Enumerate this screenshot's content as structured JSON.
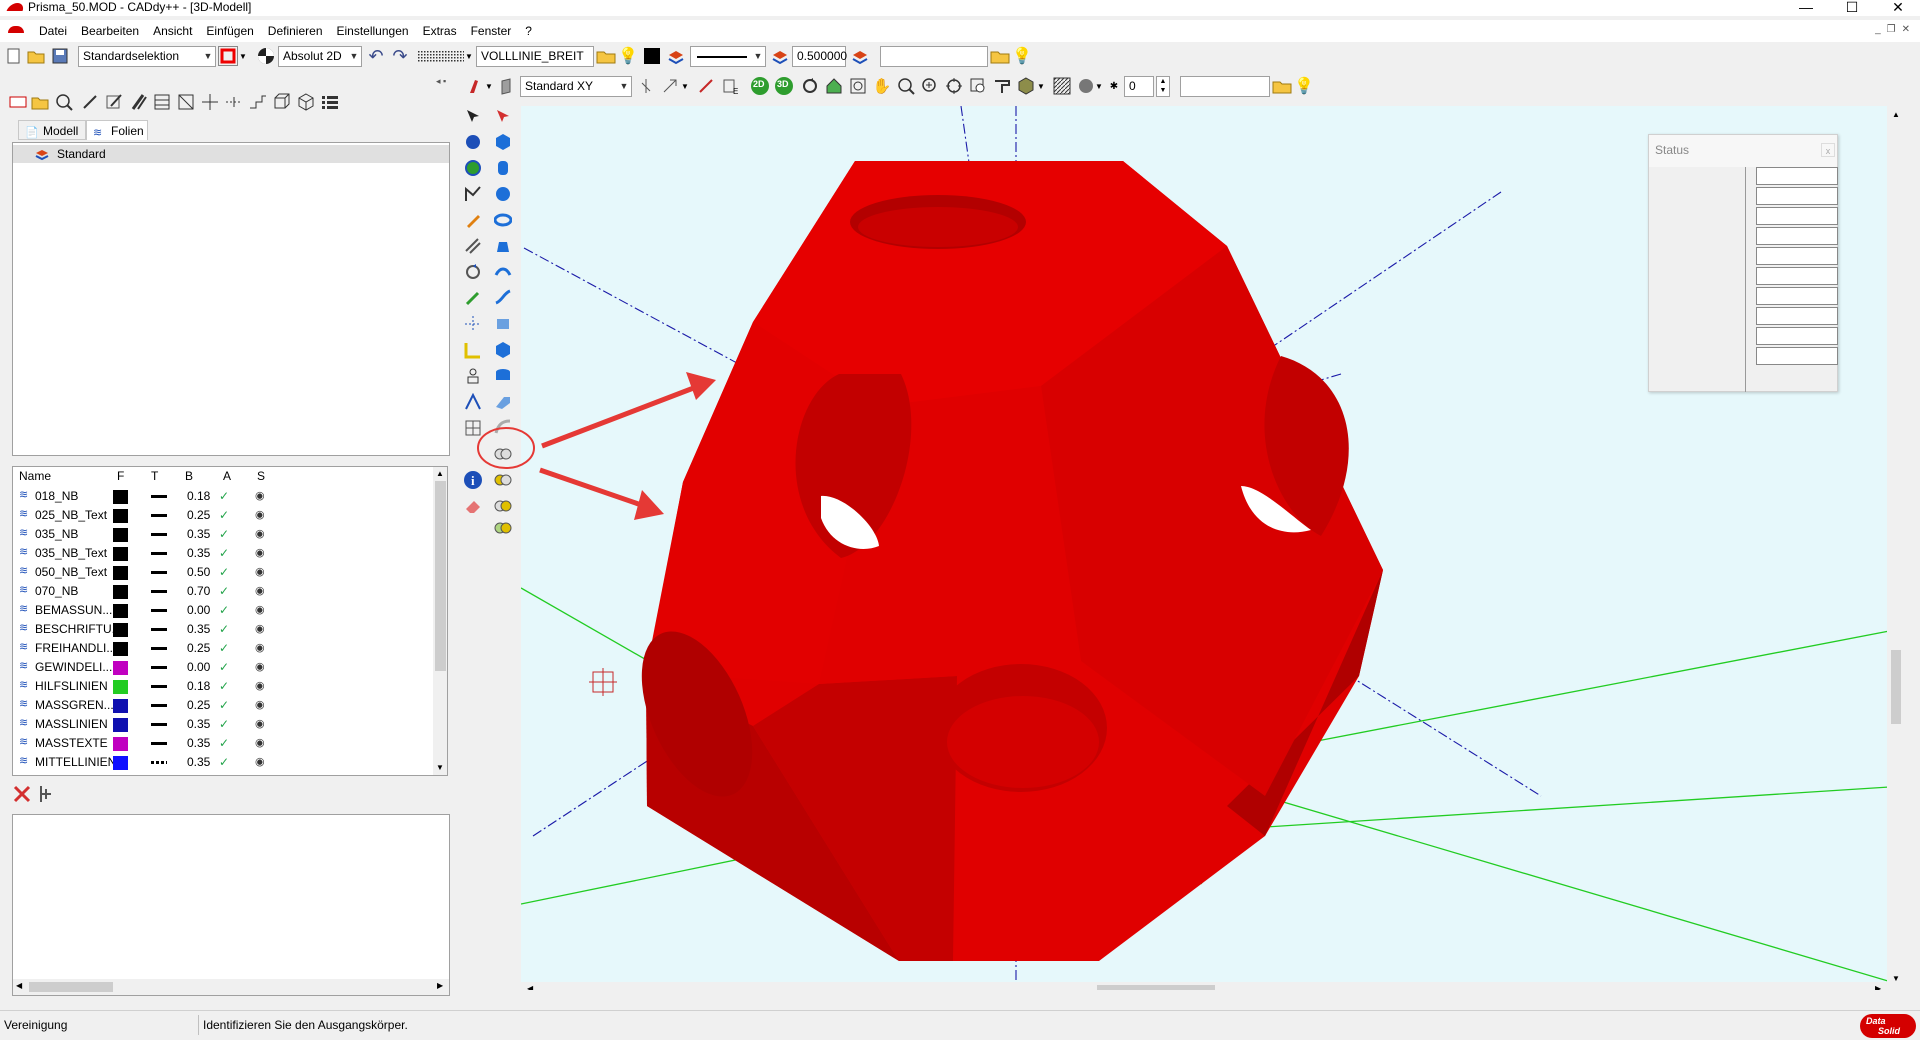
{
  "window": {
    "title": "Prisma_50.MOD  -  CADdy++ - [3D-Modell]",
    "min_label": "—",
    "max_label": "☐",
    "close_label": "✕"
  },
  "menu": {
    "items": [
      "Datei",
      "Bearbeiten",
      "Ansicht",
      "Einfügen",
      "Definieren",
      "Einstellungen",
      "Extras",
      "Fenster",
      "?"
    ]
  },
  "toolbar1": {
    "selection_mode": "Standardselektion",
    "coordinate_mode": "Absolut 2D",
    "line_type": "VOLLLINIE_BREIT",
    "line_width": "0.500000",
    "empty_field": ""
  },
  "toolbar2": {
    "view_plane": "Standard XY",
    "label_2d": "2D",
    "label_3d": "3D",
    "spin_value": "0",
    "empty_field": ""
  },
  "left_panel": {
    "tabs": [
      "Modell",
      "Folien"
    ],
    "tree_items": [
      "Standard"
    ],
    "table_headers": [
      "Name",
      "F",
      "T",
      "B",
      "A",
      "S"
    ],
    "layers": [
      {
        "name": "018_NB",
        "color": "#000000",
        "width": "0.18",
        "line": "solid"
      },
      {
        "name": "025_NB_Text",
        "color": "#000000",
        "width": "0.25",
        "line": "solid"
      },
      {
        "name": "035_NB",
        "color": "#000000",
        "width": "0.35",
        "line": "solid"
      },
      {
        "name": "035_NB_Text",
        "color": "#000000",
        "width": "0.35",
        "line": "solid"
      },
      {
        "name": "050_NB_Text",
        "color": "#000000",
        "width": "0.50",
        "line": "solid"
      },
      {
        "name": "070_NB",
        "color": "#000000",
        "width": "0.70",
        "line": "solid"
      },
      {
        "name": "BEMASSUN...",
        "color": "#000000",
        "width": "0.00",
        "line": "solid"
      },
      {
        "name": "BESCHRIFTU...",
        "color": "#000000",
        "width": "0.35",
        "line": "solid"
      },
      {
        "name": "FREIHANDLI...",
        "color": "#000000",
        "width": "0.25",
        "line": "solid"
      },
      {
        "name": "GEWINDELI...",
        "color": "#c000c0",
        "width": "0.00",
        "line": "solid"
      },
      {
        "name": "HILFSLINIEN",
        "color": "#22cc22",
        "width": "0.18",
        "line": "solid"
      },
      {
        "name": "MASSGREN...",
        "color": "#1010b0",
        "width": "0.25",
        "line": "solid"
      },
      {
        "name": "MASSLINIEN",
        "color": "#1010b0",
        "width": "0.35",
        "line": "solid"
      },
      {
        "name": "MASSTEXTE",
        "color": "#c000c0",
        "width": "0.35",
        "line": "solid"
      },
      {
        "name": "MITTELLINIEN",
        "color": "#1010ff",
        "width": "0.35",
        "line": "dashed"
      }
    ]
  },
  "status_window": {
    "title": "Status",
    "close_label": "x"
  },
  "statusbar": {
    "command": "Vereinigung",
    "prompt": "Identifizieren Sie den Ausgangskörper."
  },
  "brand": {
    "logo_line1": "Data",
    "logo_line2": "Solid"
  },
  "colors": {
    "model_red": "#e00000",
    "viewport_bg": "#e6f8fb",
    "grid_green": "#22cc22",
    "axis_blue": "#1a1aa8",
    "annotation_red": "#e53935"
  }
}
